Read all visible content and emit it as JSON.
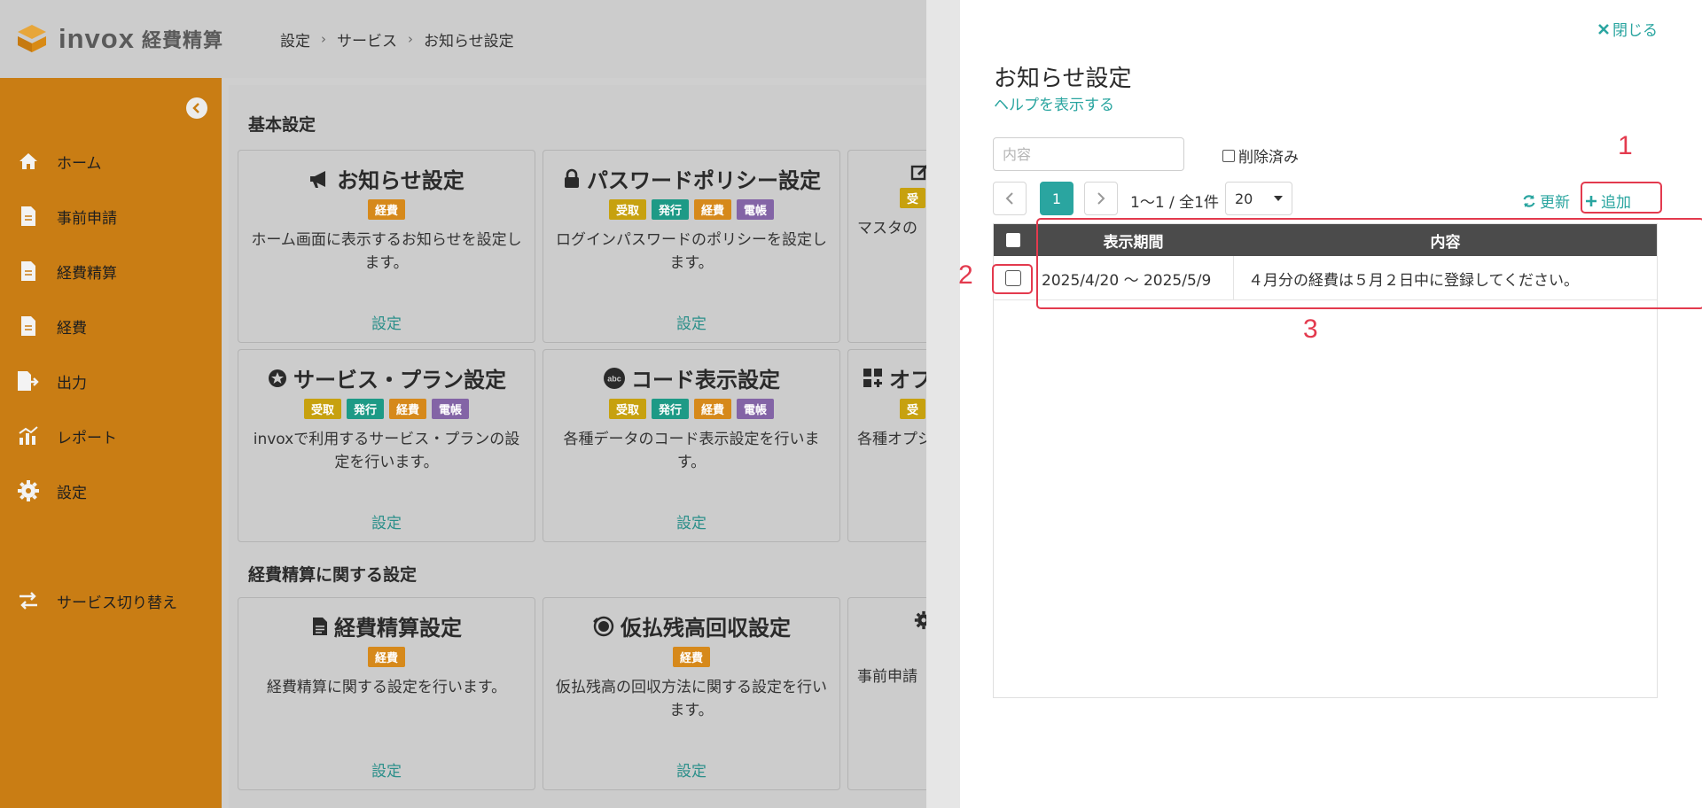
{
  "app": {
    "logo_text": "invox",
    "logo_sub": "経費精算"
  },
  "breadcrumb": [
    "設定",
    "サービス",
    "お知らせ設定"
  ],
  "sidebar": {
    "items": [
      {
        "label": "ホーム",
        "icon": "home-icon"
      },
      {
        "label": "事前申請",
        "icon": "document-icon"
      },
      {
        "label": "経費精算",
        "icon": "document-icon"
      },
      {
        "label": "経費",
        "icon": "document-icon"
      },
      {
        "label": "出力",
        "icon": "export-icon"
      },
      {
        "label": "レポート",
        "icon": "chart-icon"
      },
      {
        "label": "設定",
        "icon": "gear-icon"
      }
    ],
    "switch_service": "サービス切り替え"
  },
  "main": {
    "section_basic": "基本設定",
    "section_expense": "経費精算に関する設定",
    "cards": [
      {
        "title": "お知らせ設定",
        "badges": [
          "経費"
        ],
        "desc": "ホーム画面に表示するお知らせを設定します。",
        "link": "設定"
      },
      {
        "title": "パスワードポリシー設定",
        "badges": [
          "受取",
          "発行",
          "経費",
          "電帳"
        ],
        "desc": "ログインパスワードのポリシーを設定します。",
        "link": "設定"
      },
      {
        "title": "",
        "badges": [
          "受"
        ],
        "desc": "マスタの",
        "link": ""
      },
      {
        "title": "サービス・プラン設定",
        "badges": [
          "受取",
          "発行",
          "経費",
          "電帳"
        ],
        "desc": "invoxで利用するサービス・プランの設定を行います。",
        "link": "設定"
      },
      {
        "title": "コード表示設定",
        "badges": [
          "受取",
          "発行",
          "経費",
          "電帳"
        ],
        "desc": "各種データのコード表示設定を行います。",
        "link": "設定"
      },
      {
        "title": "オフ",
        "badges": [
          "受"
        ],
        "desc": "各種オプシ",
        "link": ""
      },
      {
        "title": "経費精算設定",
        "badges": [
          "経費"
        ],
        "desc": "経費精算に関する設定を行います。",
        "link": "設定"
      },
      {
        "title": "仮払残高回収設定",
        "badges": [
          "経費"
        ],
        "desc": "仮払残高の回収方法に関する設定を行います。",
        "link": "設定"
      },
      {
        "title": "",
        "badges": [],
        "desc": "事前申請",
        "link": ""
      }
    ]
  },
  "panel": {
    "close_label": "閉じる",
    "title": "お知らせ設定",
    "help_link": "ヘルプを表示する",
    "search_placeholder": "内容",
    "deleted_label": "削除済み",
    "page_current": "1",
    "page_info": "1〜1 / 全1件",
    "per_page": "20",
    "refresh_label": "更新",
    "add_label": "追加",
    "table": {
      "headers": [
        "表示期間",
        "内容"
      ],
      "rows": [
        {
          "period": "2025/4/20 〜 2025/5/9",
          "content": "４月分の経費は５月２日中に登録してください。"
        }
      ]
    }
  },
  "annotations": [
    "1",
    "2",
    "3"
  ],
  "colors": {
    "sidebar": "#c97d14",
    "accent": "#2aa5a0",
    "annotation": "#e33a4e",
    "table_header": "#4b4b4b"
  }
}
